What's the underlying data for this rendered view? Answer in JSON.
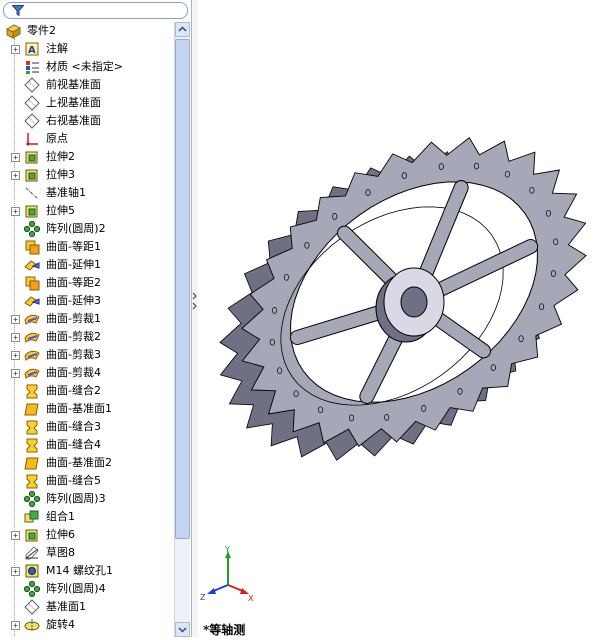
{
  "filter": {
    "icon": "filter-icon"
  },
  "tree": {
    "root": {
      "label": "零件2",
      "icon": "part-icon"
    },
    "items": [
      {
        "label": "注解",
        "icon": "annotation-icon",
        "expandable": true
      },
      {
        "label": "材质 <未指定>",
        "icon": "material-icon",
        "expandable": false
      },
      {
        "label": "前视基准面",
        "icon": "plane-icon",
        "expandable": false
      },
      {
        "label": "上视基准面",
        "icon": "plane-icon",
        "expandable": false
      },
      {
        "label": "右视基准面",
        "icon": "plane-icon",
        "expandable": false
      },
      {
        "label": "原点",
        "icon": "origin-icon",
        "expandable": false
      },
      {
        "label": "拉伸2",
        "icon": "extrude-icon",
        "expandable": true
      },
      {
        "label": "拉伸3",
        "icon": "extrude-icon",
        "expandable": true
      },
      {
        "label": "基准轴1",
        "icon": "axis-icon",
        "expandable": false
      },
      {
        "label": "拉伸5",
        "icon": "extrude-icon",
        "expandable": true
      },
      {
        "label": "阵列(圆周)2",
        "icon": "circular-pattern-icon",
        "expandable": false
      },
      {
        "label": "曲面-等距1",
        "icon": "surface-offset-icon",
        "expandable": false
      },
      {
        "label": "曲面-延伸1",
        "icon": "surface-extend-icon",
        "expandable": false
      },
      {
        "label": "曲面-等距2",
        "icon": "surface-offset-icon",
        "expandable": false
      },
      {
        "label": "曲面-延伸3",
        "icon": "surface-extend-icon",
        "expandable": false
      },
      {
        "label": "曲面-剪裁1",
        "icon": "surface-trim-icon",
        "expandable": true
      },
      {
        "label": "曲面-剪裁2",
        "icon": "surface-trim-icon",
        "expandable": true
      },
      {
        "label": "曲面-剪裁3",
        "icon": "surface-trim-icon",
        "expandable": true
      },
      {
        "label": "曲面-剪裁4",
        "icon": "surface-trim-icon",
        "expandable": true
      },
      {
        "label": "曲面-缝合2",
        "icon": "surface-knit-icon",
        "expandable": false
      },
      {
        "label": "曲面-基准面1",
        "icon": "planar-surface-icon",
        "expandable": false
      },
      {
        "label": "曲面-缝合3",
        "icon": "surface-knit-icon",
        "expandable": false
      },
      {
        "label": "曲面-缝合4",
        "icon": "surface-knit-icon",
        "expandable": false
      },
      {
        "label": "曲面-基准面2",
        "icon": "planar-surface-icon",
        "expandable": false
      },
      {
        "label": "曲面-缝合5",
        "icon": "surface-knit-icon",
        "expandable": false
      },
      {
        "label": "阵列(圆周)3",
        "icon": "circular-pattern-icon",
        "expandable": false
      },
      {
        "label": "组合1",
        "icon": "combine-icon",
        "expandable": false
      },
      {
        "label": "拉伸6",
        "icon": "extrude-icon",
        "expandable": true
      },
      {
        "label": "草图8",
        "icon": "sketch-icon",
        "expandable": false
      },
      {
        "label": "M14 螺纹孔1",
        "icon": "hole-wizard-icon",
        "expandable": true
      },
      {
        "label": "阵列(圆周)4",
        "icon": "circular-pattern-icon",
        "expandable": false
      },
      {
        "label": "基准面1",
        "icon": "plane-icon",
        "expandable": false
      },
      {
        "label": "旋转4",
        "icon": "revolve-icon",
        "expandable": true
      }
    ]
  },
  "triad": {
    "x_label": "X",
    "y_label": "Y",
    "z_label": "Z"
  },
  "view": {
    "name": "*等轴测"
  },
  "colors": {
    "model_face": "#a6a8b8",
    "model_dark": "#6f7084",
    "model_light": "#d8d9e4",
    "edge": "#000000"
  }
}
